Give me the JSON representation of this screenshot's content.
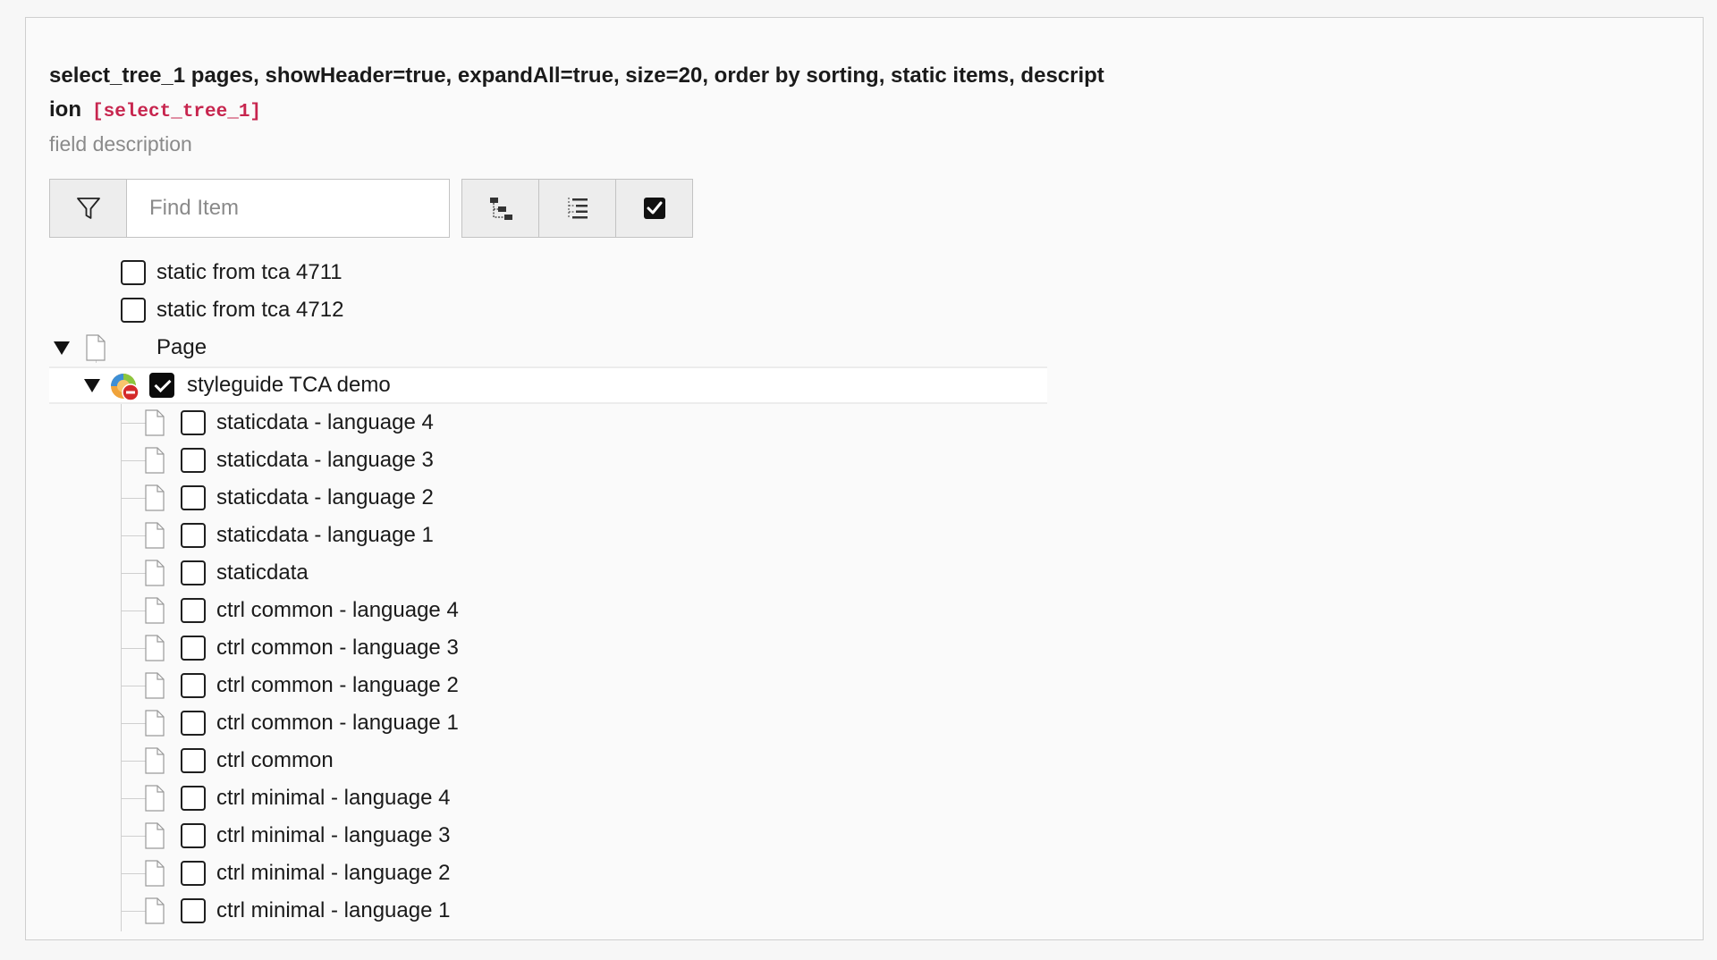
{
  "field": {
    "label": "select_tree_1 pages, showHeader=true, expandAll=true, size=20, order by sorting, static items, description",
    "code": "[select_tree_1]",
    "description": "field description"
  },
  "toolbar": {
    "filter_placeholder": "Find Item",
    "buttons": [
      "expand-collapse-all",
      "toggle-list-view",
      "show-checked-only"
    ]
  },
  "tree": {
    "items": [
      {
        "label": "static from tca 4711",
        "checked": false
      },
      {
        "label": "static from tca 4712",
        "checked": false
      },
      {
        "label": "Page"
      },
      {
        "label": "styleguide TCA demo",
        "checked": true
      },
      {
        "label": "staticdata - language 4",
        "checked": false
      },
      {
        "label": "staticdata - language 3",
        "checked": false
      },
      {
        "label": "staticdata - language 2",
        "checked": false
      },
      {
        "label": "staticdata - language 1",
        "checked": false
      },
      {
        "label": "staticdata",
        "checked": false
      },
      {
        "label": "ctrl common - language 4",
        "checked": false
      },
      {
        "label": "ctrl common - language 3",
        "checked": false
      },
      {
        "label": "ctrl common - language 2",
        "checked": false
      },
      {
        "label": "ctrl common - language 1",
        "checked": false
      },
      {
        "label": "ctrl common",
        "checked": false
      },
      {
        "label": "ctrl minimal - language 4",
        "checked": false
      },
      {
        "label": "ctrl minimal - language 3",
        "checked": false
      },
      {
        "label": "ctrl minimal - language 2",
        "checked": false
      },
      {
        "label": "ctrl minimal - language 1",
        "checked": false
      }
    ]
  },
  "colors": {
    "code_accent": "#c7254e",
    "checked": "#0b0b0b",
    "border": "#c3c3c3"
  }
}
